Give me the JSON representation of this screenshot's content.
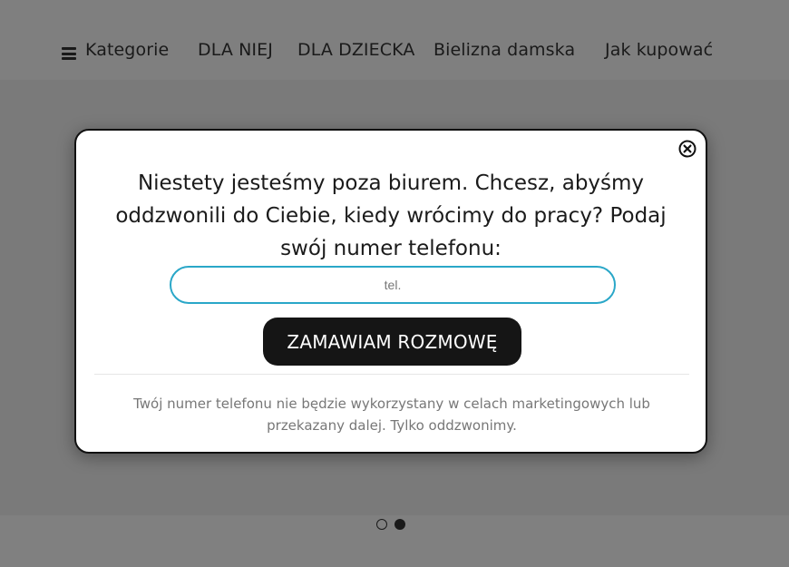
{
  "nav": {
    "menu_label": "Kategorie",
    "items": [
      {
        "label": "DLA NIEJ"
      },
      {
        "label": "DLA DZIECKA"
      },
      {
        "label": "Bielizna damska"
      },
      {
        "label": "Jak kupować"
      }
    ]
  },
  "slider": {
    "dot_count": 2,
    "active_dot": 2
  },
  "popup": {
    "message": "Niestety jesteśmy poza biurem. Chcesz, abyśmy oddzwonili do Ciebie, kiedy wrócimy do pracy? Podaj swój numer telefonu:",
    "phone_value": "",
    "phone_placeholder": "tel.",
    "submit_label": "ZAMAWIAM ROZMOWĘ",
    "disclaimer": "Twój numer telefonu nie będzie wykorzystany w celach marketingowych lub przekazany dalej. Tylko oddzwonimy.",
    "close_icon": "close-circle-icon"
  },
  "colors": {
    "overlay": "#808080",
    "popup_bg": "#ffffff",
    "input_border": "#2aa7c8",
    "button_bg": "#151515",
    "button_text": "#ffffff"
  }
}
